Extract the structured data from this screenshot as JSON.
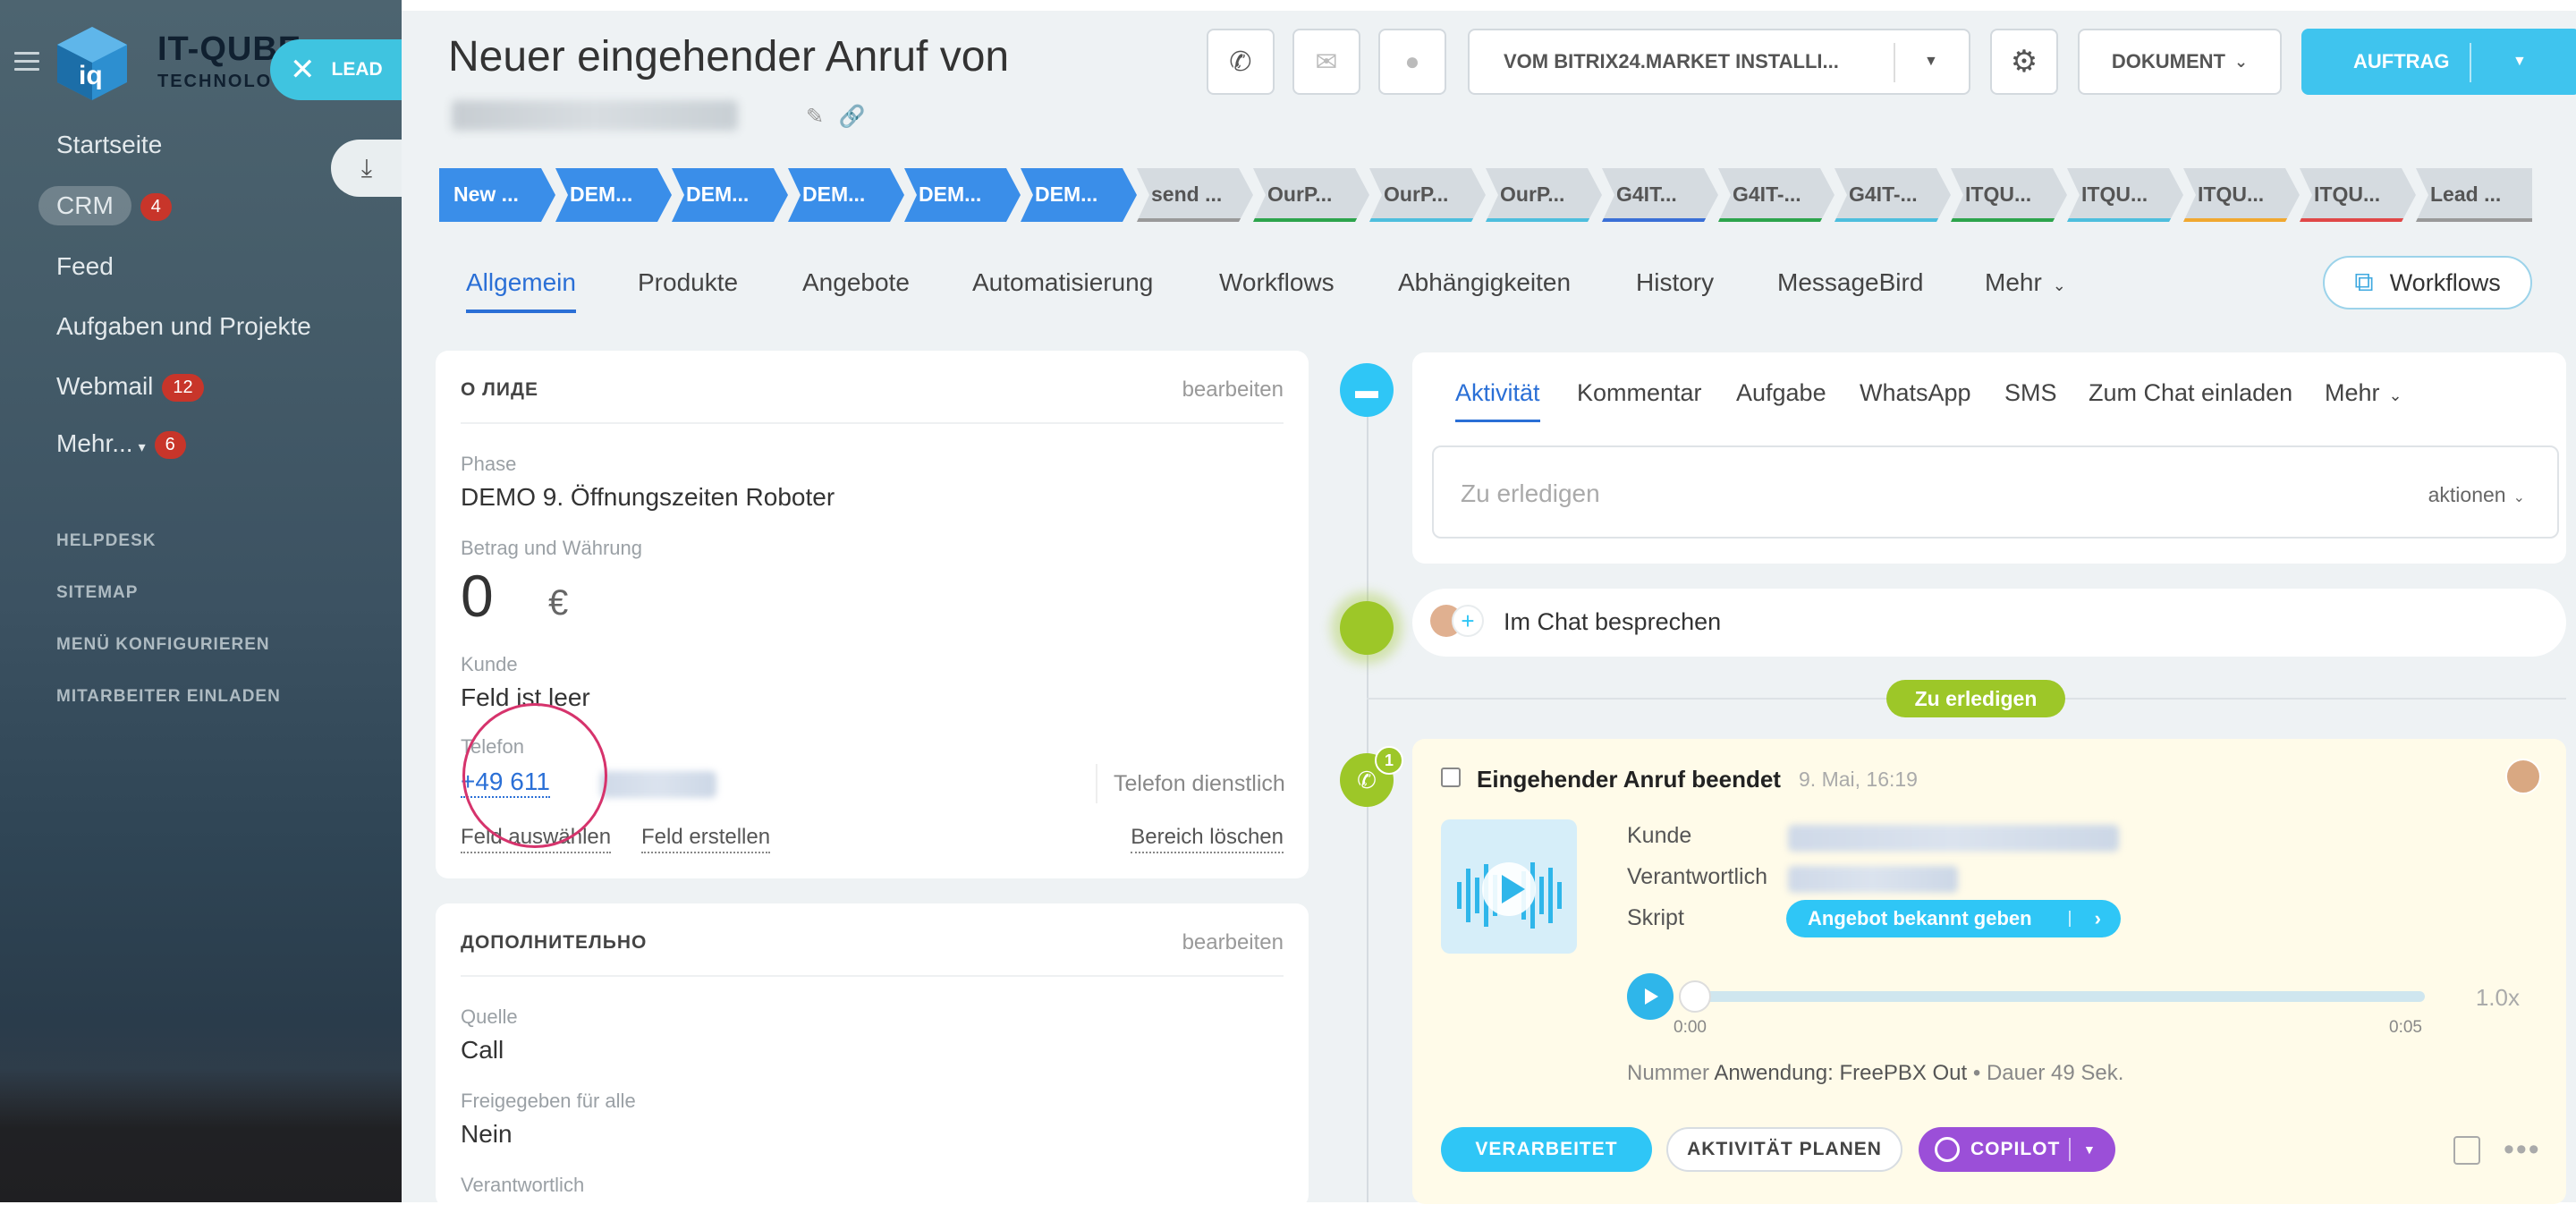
{
  "sidebar": {
    "logo_text": "IT-QUBE",
    "logo_sub": "TECHNOLOGY",
    "lead_badge": "LEAD",
    "nav": [
      {
        "label": "Startseite"
      },
      {
        "label": "CRM",
        "badge": "4"
      },
      {
        "label": "Feed"
      },
      {
        "label": "Aufgaben und Projekte"
      },
      {
        "label": "Webmail",
        "badge": "12"
      },
      {
        "label": "Mehr...",
        "badge": "6"
      }
    ],
    "secondary": [
      "HELPDESK",
      "SITEMAP",
      "MENÜ KONFIGURIEREN",
      "MITARBEITER EINLADEN"
    ]
  },
  "header": {
    "title": "Neuer eingehender Anruf von",
    "app_button": "VOM BITRIX24.MARKET INSTALLI...",
    "document_button": "DOKUMENT",
    "order_button": "AUFTRAG"
  },
  "stages": [
    "New ...",
    "DEM...",
    "DEM...",
    "DEM...",
    "DEM...",
    "DEM...",
    "send ...",
    "OurP...",
    "OurP...",
    "OurP...",
    "G4IT...",
    "G4IT-...",
    "G4IT-...",
    "ITQU...",
    "ITQU...",
    "ITQU...",
    "ITQU...",
    "Lead ..."
  ],
  "stage_colors": [
    "#3a8ee9",
    "#3a8ee9",
    "#3a8ee9",
    "#3a8ee9",
    "#3a8ee9",
    "#3a8ee9",
    "#999999",
    "#2ca44c",
    "#4dbedd",
    "#4dbedd",
    "#3a6fd6",
    "#2ca44c",
    "#4dbedd",
    "#2ca44c",
    "#4dbedd",
    "#f0a830",
    "#e04848",
    "#999999"
  ],
  "tabs": [
    "Allgemein",
    "Produkte",
    "Angebote",
    "Automatisierung",
    "Workflows",
    "Abhängigkeiten",
    "History",
    "MessageBird",
    "Mehr"
  ],
  "workflows_button": "Workflows",
  "about": {
    "section_title": "О ЛИДЕ",
    "edit": "bearbeiten",
    "phase_label": "Phase",
    "phase_value": "DEMO 9. Öffnungszeiten Roboter",
    "amount_label": "Betrag und Währung",
    "amount_value": "0",
    "currency": "€",
    "customer_label": "Kunde",
    "customer_value": "Feld ist leer",
    "phone_label": "Telefon",
    "phone_value": "+49 611",
    "phone_type": "Telefon dienstlich",
    "select_field": "Feld auswählen",
    "create_field": "Feld erstellen",
    "clear_section": "Bereich löschen"
  },
  "additional": {
    "section_title": "ДОПОЛНИТЕЛЬНО",
    "edit": "bearbeiten",
    "source_label": "Quelle",
    "source_value": "Call",
    "shared_label": "Freigegeben für alle",
    "shared_value": "Nein",
    "responsible_label": "Verantwortlich"
  },
  "activity": {
    "tabs": [
      "Aktivität",
      "Kommentar",
      "Aufgabe",
      "WhatsApp",
      "SMS",
      "Zum Chat einladen",
      "Mehr"
    ],
    "todo_placeholder": "Zu erledigen",
    "actions": "aktionen",
    "chat_discuss": "Im Chat besprechen",
    "todo_pill": "Zu erledigen",
    "call": {
      "title": "Eingehender Anruf beendet",
      "time": "9. Mai, 16:19",
      "counter": "1",
      "customer_label": "Kunde",
      "responsible_label": "Verantwortlich",
      "script_label": "Skript",
      "script_button": "Angebot bekannt geben",
      "speed": "1.0x",
      "time_start": "0:00",
      "time_end": "0:05",
      "number_label": "Nummer",
      "number_value": "Anwendung: FreePBX Out",
      "duration": "• Dauer 49 Sek.",
      "btn_done": "VERARBEITET",
      "btn_plan": "AKTIVITÄT PLANEN",
      "btn_copilot": "COPILOT"
    }
  }
}
